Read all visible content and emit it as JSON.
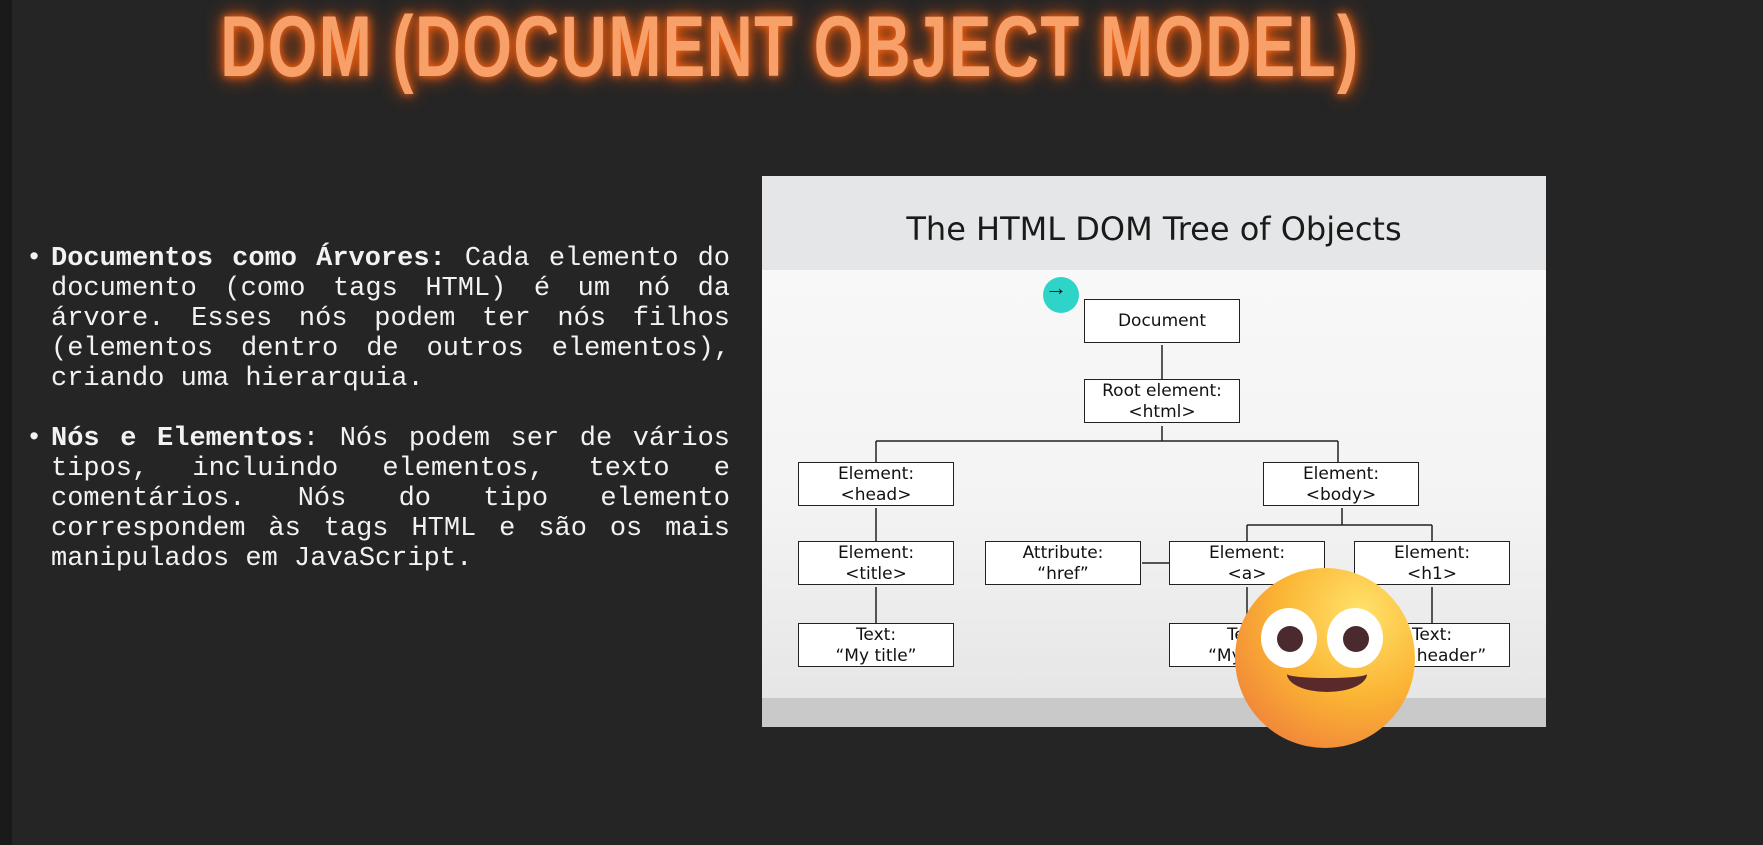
{
  "slide": {
    "title": "DOM (DOCUMENT OBJECT MODEL)",
    "bullets": [
      {
        "heading": "Documentos como Árvores:",
        "text": " Cada elemento do documento (como tags HTML) é um nó da árvore. Esses nós podem ter nós filhos (elementos dentro de outros elementos), criando uma hierarquia."
      },
      {
        "heading": "Nós e Elementos",
        "text": ": Nós podem ser de vários tipos, incluindo elementos, texto e comentários. Nós do tipo elemento correspondem às tags HTML e são os mais manipulados em JavaScript."
      }
    ]
  },
  "diagram": {
    "title": "The HTML DOM Tree of Objects",
    "nodes": {
      "document": {
        "l1": "Document"
      },
      "root": {
        "l1": "Root element:",
        "l2": "<html>"
      },
      "head": {
        "l1": "Element:",
        "l2": "<head>"
      },
      "body": {
        "l1": "Element:",
        "l2": "<body>"
      },
      "title": {
        "l1": "Element:",
        "l2": "<title>"
      },
      "attribute": {
        "l1": "Attribute:",
        "l2": "“href”"
      },
      "a": {
        "l1": "Element:",
        "l2": "<a>"
      },
      "h1": {
        "l1": "Element:",
        "l2": "<h1>"
      },
      "text_title": {
        "l1": "Text:",
        "l2": "“My title”"
      },
      "text_a": {
        "l1": "Text:",
        "l2": "“My link”"
      },
      "text_h1": {
        "l1": "Text:",
        "l2": "“My header”"
      }
    }
  },
  "overlay": {
    "cursor_icon": "arrow-right-icon",
    "emoji_icon": "smiling-face-emoji"
  },
  "colors": {
    "title": "#f7a06a",
    "background": "#252525",
    "cursor": "#2fd4c8"
  }
}
